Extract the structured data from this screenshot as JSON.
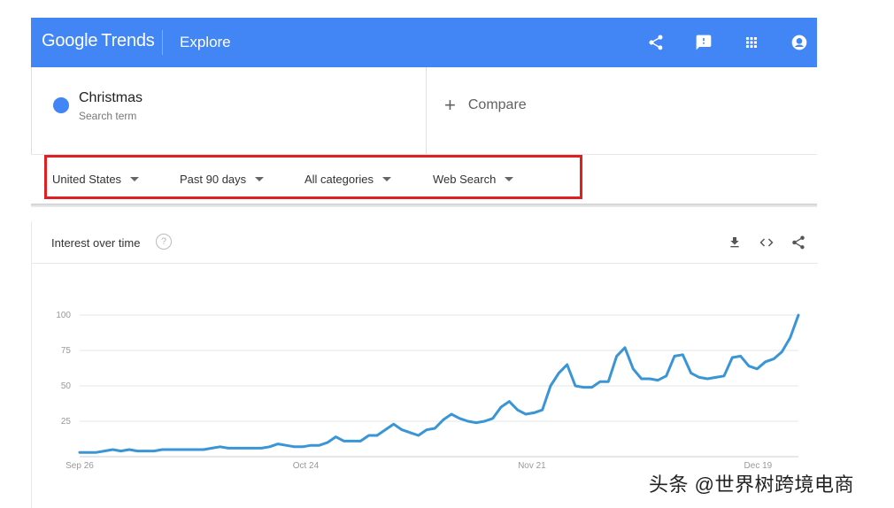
{
  "header": {
    "logo_google": "Google",
    "logo_trends": "Trends",
    "section": "Explore",
    "colors": {
      "bar": "#4285f4"
    }
  },
  "term": {
    "name": "Christmas",
    "sub": "Search term",
    "color": "#4285f4"
  },
  "compare": {
    "plus": "+",
    "label": "Compare"
  },
  "filters": [
    {
      "label": "United States"
    },
    {
      "label": "Past 90 days"
    },
    {
      "label": "All categories"
    },
    {
      "label": "Web Search"
    }
  ],
  "card": {
    "title": "Interest over time",
    "help": "?"
  },
  "icons": [
    "share-icon",
    "feedback-icon",
    "apps-icon",
    "account-icon",
    "download-icon",
    "embed-icon",
    "share-icon"
  ],
  "chart_data": {
    "type": "line",
    "x_ticks": [
      "Sep 26",
      "Oct 24",
      "Nov 21",
      "Dec 19"
    ],
    "y_ticks": [
      25,
      50,
      75,
      100
    ],
    "ylim": [
      0,
      100
    ],
    "grid": true,
    "series": [
      {
        "color": "#3a95d6",
        "values": [
          3,
          3,
          3,
          4,
          5,
          4,
          5,
          4,
          4,
          4,
          5,
          5,
          5,
          5,
          5,
          5,
          6,
          7,
          6,
          6,
          6,
          6,
          6,
          7,
          9,
          8,
          7,
          7,
          8,
          8,
          10,
          14,
          11,
          11,
          11,
          15,
          15,
          19,
          23,
          19,
          17,
          15,
          19,
          20,
          26,
          30,
          27,
          25,
          24,
          25,
          27,
          35,
          39,
          33,
          30,
          31,
          33,
          50,
          59,
          65,
          50,
          49,
          49,
          53,
          53,
          71,
          77,
          62,
          55,
          55,
          54,
          57,
          71,
          72,
          59,
          56,
          55,
          56,
          57,
          70,
          71,
          64,
          62,
          67,
          69,
          74,
          84,
          100
        ]
      }
    ]
  },
  "watermark": "头条 @世界树跨境电商"
}
